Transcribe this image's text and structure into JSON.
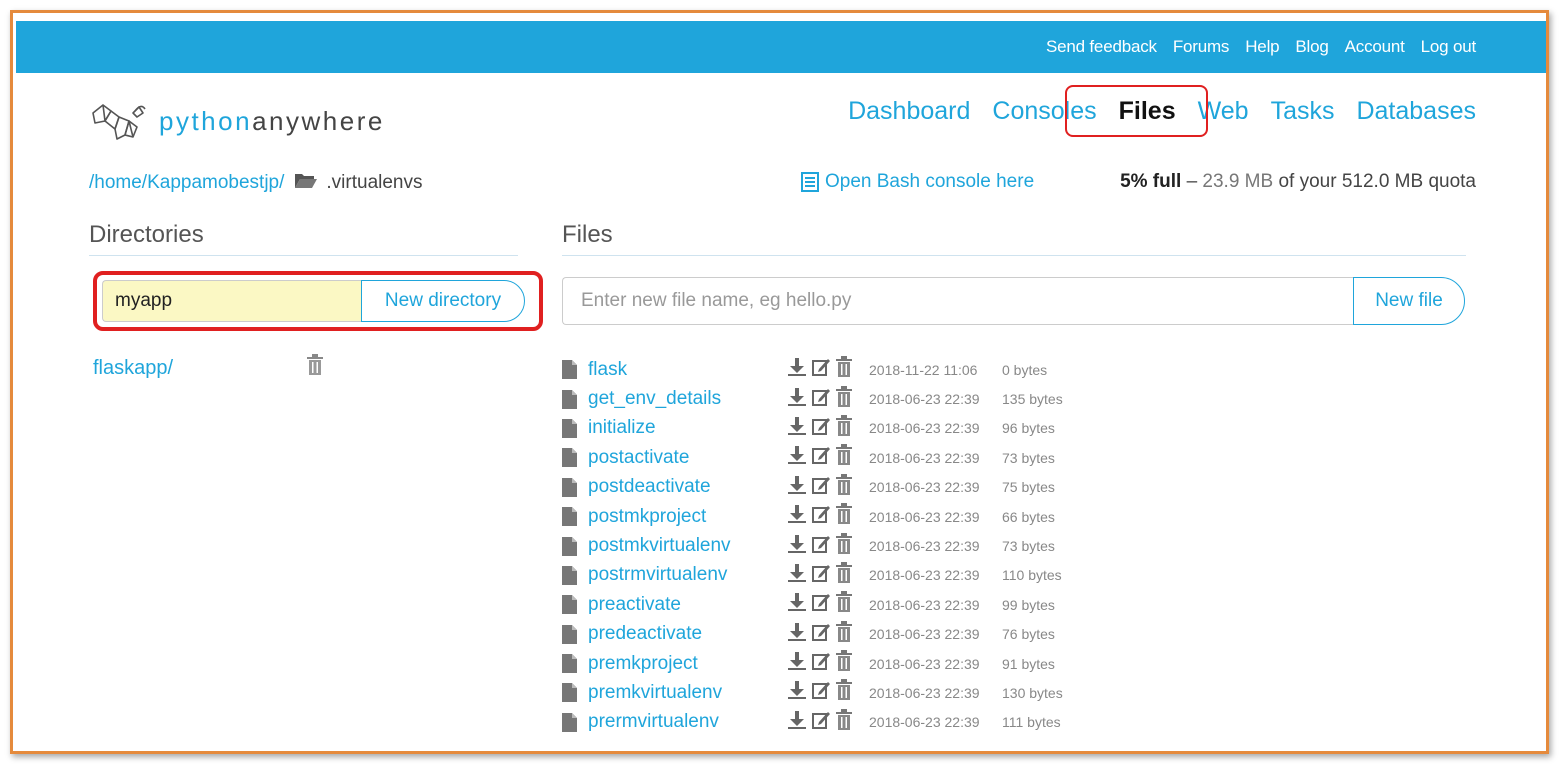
{
  "topbar": {
    "links": [
      "Send feedback",
      "Forums",
      "Help",
      "Blog",
      "Account",
      "Log out"
    ]
  },
  "logo": {
    "part1": "python",
    "part2": "anywhere"
  },
  "nav": [
    "Dashboard",
    "Consoles",
    "Files",
    "Web",
    "Tasks",
    "Databases"
  ],
  "nav_active": "Files",
  "breadcrumb": {
    "path": "/home/Kappamobestjp/",
    "current": ".virtualenvs"
  },
  "bash_link": "Open Bash console here",
  "quota": {
    "percent": "5% full",
    "sep": " – ",
    "used": "23.9 MB",
    "mid": " of your ",
    "total": "512.0 MB quota"
  },
  "directories": {
    "title": "Directories",
    "input_value": "myapp",
    "button": "New directory",
    "items": [
      "flaskapp/"
    ]
  },
  "files": {
    "title": "Files",
    "placeholder": "Enter new file name, eg hello.py",
    "button": "New file",
    "items": [
      {
        "name": "flask",
        "date": "2018-11-22 11:06",
        "size": "0 bytes"
      },
      {
        "name": "get_env_details",
        "date": "2018-06-23 22:39",
        "size": "135 bytes"
      },
      {
        "name": "initialize",
        "date": "2018-06-23 22:39",
        "size": "96 bytes"
      },
      {
        "name": "postactivate",
        "date": "2018-06-23 22:39",
        "size": "73 bytes"
      },
      {
        "name": "postdeactivate",
        "date": "2018-06-23 22:39",
        "size": "75 bytes"
      },
      {
        "name": "postmkproject",
        "date": "2018-06-23 22:39",
        "size": "66 bytes"
      },
      {
        "name": "postmkvirtualenv",
        "date": "2018-06-23 22:39",
        "size": "73 bytes"
      },
      {
        "name": "postrmvirtualenv",
        "date": "2018-06-23 22:39",
        "size": "110 bytes"
      },
      {
        "name": "preactivate",
        "date": "2018-06-23 22:39",
        "size": "99 bytes"
      },
      {
        "name": "predeactivate",
        "date": "2018-06-23 22:39",
        "size": "76 bytes"
      },
      {
        "name": "premkproject",
        "date": "2018-06-23 22:39",
        "size": "91 bytes"
      },
      {
        "name": "premkvirtualenv",
        "date": "2018-06-23 22:39",
        "size": "130 bytes"
      },
      {
        "name": "prermvirtualenv",
        "date": "2018-06-23 22:39",
        "size": "111 bytes"
      }
    ]
  },
  "colors": {
    "brand": "#1fa5db",
    "highlight": "#e02020",
    "frame": "#e58a3c",
    "input_bg": "#fbf8c4"
  }
}
